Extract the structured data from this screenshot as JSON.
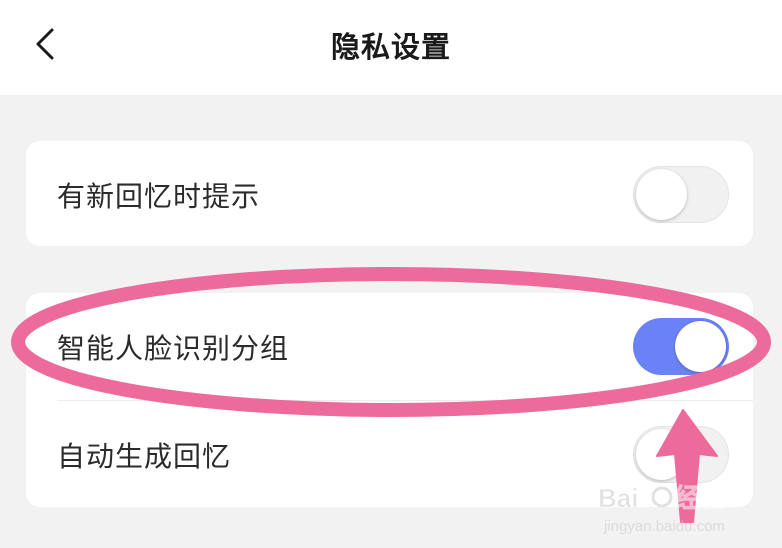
{
  "header": {
    "title": "隐私设置",
    "back_icon": "chevron-left-icon"
  },
  "settings": [
    {
      "label": "有新回忆时提示",
      "enabled": false
    },
    {
      "label": "智能人脸识别分组",
      "enabled": true
    },
    {
      "label": "自动生成回忆",
      "enabled": false
    }
  ],
  "colors": {
    "toggle_on": "#6b82f6",
    "annotation": "#ec6b9b",
    "background": "#f2f2f2"
  },
  "watermark": {
    "brand": "Baidu经验",
    "url": "jingyan.baidu.com"
  }
}
